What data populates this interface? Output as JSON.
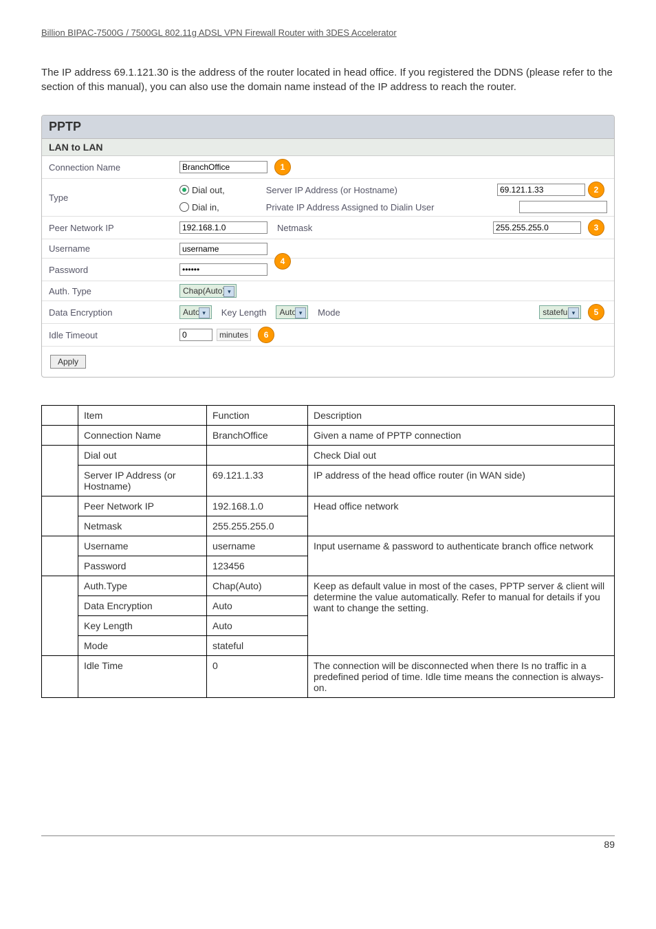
{
  "header": "Billion BIPAC-7500G / 7500GL 802.11g ADSL VPN Firewall Router with 3DES Accelerator",
  "intro_1": "The IP address 69.1.121.30 is the",
  "intro_2": "address of the router located in head office. If you registered the DDNS (please refer to the",
  "intro_3": "section of this manual), you can also use the domain name instead of the IP address to reach the router.",
  "pptp": {
    "title": "PPTP",
    "section": "LAN to LAN",
    "labels": {
      "connection_name": "Connection Name",
      "type": "Type",
      "peer_network_ip": "Peer Network IP",
      "username": "Username",
      "password": "Password",
      "auth_type": "Auth. Type",
      "data_encryption": "Data Encryption",
      "idle_timeout": "Idle Timeout",
      "server_ip": "Server IP Address (or Hostname)",
      "private_ip": "Private IP Address Assigned to Dialin User",
      "netmask": "Netmask",
      "key_length": "Key Length",
      "mode": "Mode",
      "minutes": "minutes",
      "dial_out": "Dial out,",
      "dial_in": "Dial in,"
    },
    "values": {
      "connection_name": "BranchOffice",
      "server_ip": "69.121.1.33",
      "peer_network_ip": "192.168.1.0",
      "netmask": "255.255.255.0",
      "username": "username",
      "password": "••••••",
      "auth_type": "Chap(Auto)",
      "data_encryption": "Auto",
      "key_length": "Auto",
      "mode": "stateful",
      "idle_timeout": "0"
    },
    "apply": "Apply"
  },
  "pills": {
    "p1": "1",
    "p2": "2",
    "p3": "3",
    "p4": "4",
    "p5": "5",
    "p6": "6"
  },
  "table": {
    "headers": {
      "item": "Item",
      "function": "Function",
      "description": "Description"
    },
    "r1": {
      "item": "Connection Name",
      "func": "BranchOffice",
      "desc": "Given a name of PPTP connection"
    },
    "r2": {
      "item": "Dial out",
      "func": "",
      "desc": "Check Dial out"
    },
    "r3": {
      "item": "Server IP Address (or Hostname)",
      "func": "69.121.1.33",
      "desc": "IP address of the head office router (in WAN side)"
    },
    "r4": {
      "item": "Peer Network IP",
      "func": "192.168.1.0",
      "desc_group": "Head office network"
    },
    "r5": {
      "item": "Netmask",
      "func": "255.255.255.0"
    },
    "r6": {
      "item": "Username",
      "func": "username",
      "desc_group": "Input username & password to authenticate branch office network"
    },
    "r7": {
      "item": "Password",
      "func": "123456"
    },
    "r8": {
      "item": "Auth.Type",
      "func": "Chap(Auto)",
      "desc_group": "Keep as default value in most of the cases, PPTP server & client will determine the value automatically. Refer to manual for details if you want to change the setting."
    },
    "r9": {
      "item": "Data Encryption",
      "func": "Auto"
    },
    "r10": {
      "item": "Key Length",
      "func": "Auto"
    },
    "r11": {
      "item": "Mode",
      "func": "stateful"
    },
    "r12": {
      "item": "Idle Time",
      "func": "0",
      "desc": "The connection will be disconnected when there Is no traffic in a predefined period of time.  Idle time    means the connection is always-on."
    }
  },
  "page_number": "89"
}
